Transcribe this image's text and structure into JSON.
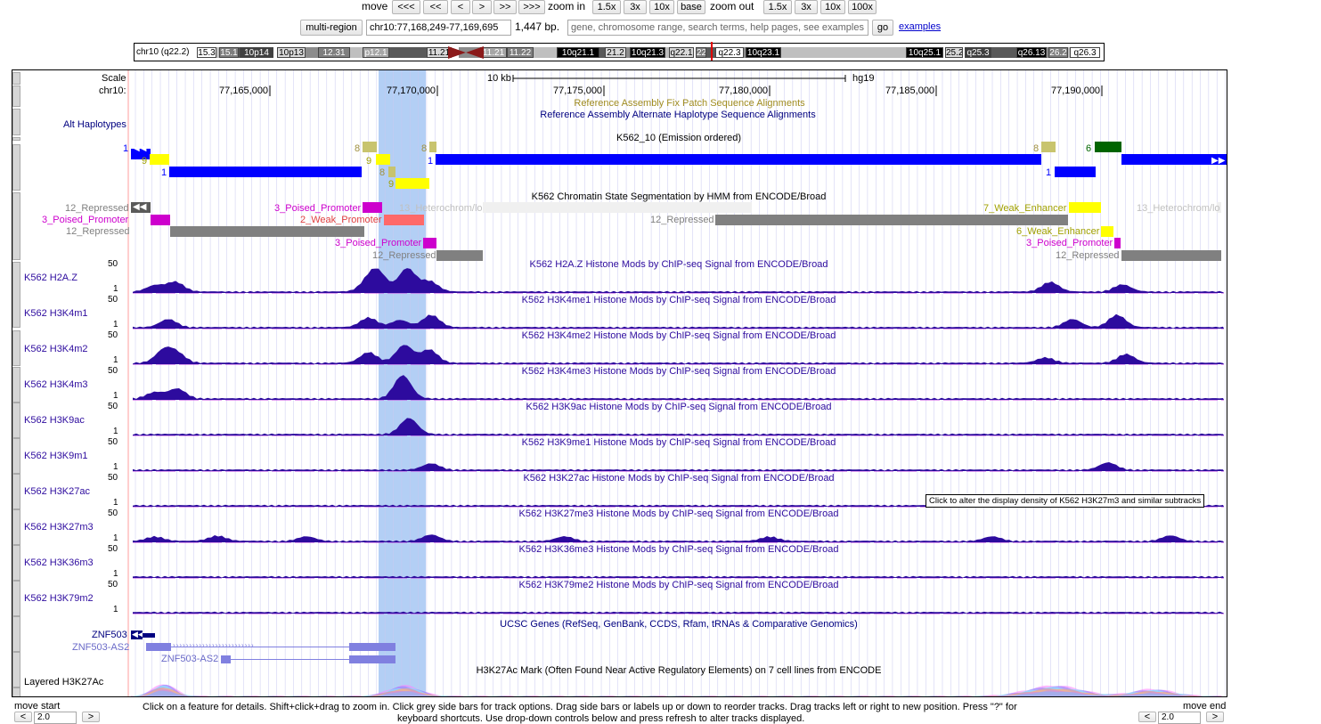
{
  "nav": {
    "move_label": "move",
    "move_buttons": [
      "<<<",
      "<<",
      "<",
      ">",
      ">>",
      ">>>"
    ],
    "zoom_in_label": "zoom in",
    "zoom_in_buttons": [
      "1.5x",
      "3x",
      "10x",
      "base"
    ],
    "zoom_out_label": "zoom out",
    "zoom_out_buttons": [
      "1.5x",
      "3x",
      "10x",
      "100x"
    ],
    "multi_region": "multi-region",
    "position": "chr10:77,168,249-77,169,695",
    "size": "1,447 bp.",
    "search_placeholder": "gene, chromosome range, search terms, help pages, see examples",
    "go": "go",
    "examples": "examples"
  },
  "ideogram": {
    "chrom_label": "chr10 (q22.2)",
    "bands": [
      "15.3",
      "15.1",
      "10p14",
      "10p13",
      "12.31",
      "p12.1",
      "11.21",
      "11.21",
      "11.22",
      "10q21.1",
      "21.2",
      "10q21.3",
      "q22.1",
      "22.",
      "q22.3",
      "10q23.1",
      "10q25.1",
      "25.2",
      "q25.3",
      "q26.13",
      "26.2",
      "q26.3"
    ]
  },
  "ruler": {
    "scale_label": "Scale",
    "chrom_label": "chr10:",
    "scale_bar_label": "10 kb",
    "assembly": "hg19",
    "positions": [
      "77,165,000",
      "77,170,000",
      "77,175,000",
      "77,180,000",
      "77,185,000",
      "77,190,000"
    ]
  },
  "tracks": {
    "fix_patch_title": "Reference Assembly Fix Patch Sequence Alignments",
    "alt_hap_title": "Reference Assembly Alternate Haplotype Sequence Alignments",
    "alt_hap_label": "Alt Haplotypes",
    "k562_10_title": "K562_10 (Emission ordered)",
    "chromhmm_title": "K562 Chromatin State Segmentation by HMM from ENCODE/Broad",
    "chromhmm_labels": [
      "12_Repressed",
      "3_Poised_Promoter",
      "12_Repressed",
      "3_Poised_Promoter",
      "2_Weak_Promoter",
      "13_Heterochrom/lo",
      "12_Repressed",
      "3_Poised_Promoter",
      "12_Repressed",
      "7_Weak_Enhancer",
      "13_Heterochrom/lo",
      "6_Weak_Enhancer",
      "3_Poised_Promoter",
      "12_Repressed"
    ],
    "emission_numbers": [
      "1",
      "9",
      "1",
      "8",
      "9",
      "8",
      "9",
      "8",
      "1",
      "8",
      "6",
      "1"
    ],
    "histone": [
      {
        "name": "K562 H2A.Z",
        "title": "K562 H2A.Z Histone Mods by ChIP-seq Signal from ENCODE/Broad",
        "max": "50",
        "min": "1"
      },
      {
        "name": "K562 H3K4m1",
        "title": "K562 H3K4me1 Histone Mods by ChIP-seq Signal from ENCODE/Broad",
        "max": "50",
        "min": "1"
      },
      {
        "name": "K562 H3K4m2",
        "title": "K562 H3K4me2 Histone Mods by ChIP-seq Signal from ENCODE/Broad",
        "max": "50",
        "min": "1"
      },
      {
        "name": "K562 H3K4m3",
        "title": "K562 H3K4me3 Histone Mods by ChIP-seq Signal from ENCODE/Broad",
        "max": "50",
        "min": "1"
      },
      {
        "name": "K562 H3K9ac",
        "title": "K562 H3K9ac Histone Mods by ChIP-seq Signal from ENCODE/Broad",
        "max": "50",
        "min": "1"
      },
      {
        "name": "K562 H3K9m1",
        "title": "K562 H3K9me1 Histone Mods by ChIP-seq Signal from ENCODE/Broad",
        "max": "50",
        "min": "1"
      },
      {
        "name": "K562 H3K27ac",
        "title": "K562 H3K27ac Histone Mods by ChIP-seq Signal from ENCODE/Broad",
        "max": "50",
        "min": "1"
      },
      {
        "name": "K562 H3K27m3",
        "title": "K562 H3K27me3 Histone Mods by ChIP-seq Signal from ENCODE/Broad",
        "max": "50",
        "min": "1"
      },
      {
        "name": "K562 H3K36m3",
        "title": "K562 H3K36me3 Histone Mods by ChIP-seq Signal from ENCODE/Broad",
        "max": "50",
        "min": "1"
      },
      {
        "name": "K562 H3K79m2",
        "title": "K562 H3K79me2 Histone Mods by ChIP-seq Signal from ENCODE/Broad",
        "max": "50",
        "min": "1"
      }
    ],
    "tooltip": "Click to alter the display density of K562 H3K27m3 and similar subtracks",
    "genes_title": "UCSC Genes (RefSeq, GenBank, CCDS, Rfam, tRNAs & Comparative Genomics)",
    "gene_labels": [
      "ZNF503",
      "ZNF503-AS2",
      "ZNF503-AS2"
    ],
    "layered_title": "H3K27Ac Mark (Often Found Near Active Regulatory Elements) on 7 cell lines from ENCODE",
    "layered_label": "Layered H3K27Ac"
  },
  "footer": {
    "move_start": "move start",
    "move_end": "move end",
    "left_value": "2.0",
    "right_value": "2.0",
    "help_line1": "Click on a feature for details. Shift+click+drag to zoom in. Click grey side bars for track options. Drag side bars or labels up or down to reorder tracks. Drag tracks left or right to new position. Press \"?\" for",
    "help_line2": "keyboard shortcuts. Use drop-down controls below and press refresh to alter tracks displayed."
  },
  "colors": {
    "highlight": "#b3cff5",
    "signal": "#2d0b9e",
    "emission_blue": "#0000ff",
    "emission_yellow": "#ffff00",
    "emission_olive": "#c8c46e",
    "emission_green": "#006400",
    "repressed_gray": "#808080",
    "poised_magenta": "#cd00cd",
    "weak_promoter_red": "#ff6969",
    "weak_enhancer_yellow": "#ffff00",
    "title_navy": "#000080",
    "title_gold": "#a08c20"
  }
}
